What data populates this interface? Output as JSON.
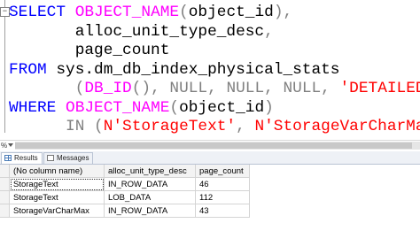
{
  "editor": {
    "lines": [
      [
        {
          "cls": "kw",
          "text": "SELECT "
        },
        {
          "cls": "fn",
          "text": "OBJECT_NAME"
        },
        {
          "cls": "gr",
          "text": "("
        },
        {
          "cls": "tx",
          "text": "object_id"
        },
        {
          "cls": "gr",
          "text": "),"
        }
      ],
      [
        {
          "cls": "tx",
          "text": "       alloc_unit_type_desc"
        },
        {
          "cls": "gr",
          "text": ","
        }
      ],
      [
        {
          "cls": "tx",
          "text": "       page_count"
        }
      ],
      [
        {
          "cls": "kw",
          "text": "FROM "
        },
        {
          "cls": "tx",
          "text": "sys.dm_db_index_physical_stats"
        }
      ],
      [
        {
          "cls": "gr",
          "text": "       ("
        },
        {
          "cls": "fn",
          "text": "DB_ID"
        },
        {
          "cls": "gr",
          "text": "(), "
        },
        {
          "cls": "gr",
          "text": "NULL"
        },
        {
          "cls": "gr",
          "text": ", "
        },
        {
          "cls": "gr",
          "text": "NULL"
        },
        {
          "cls": "gr",
          "text": ", "
        },
        {
          "cls": "gr",
          "text": "NULL"
        },
        {
          "cls": "gr",
          "text": ", "
        },
        {
          "cls": "str",
          "text": "'DETAILED'"
        },
        {
          "cls": "gr",
          "text": ")"
        }
      ],
      [
        {
          "cls": "kw",
          "text": "WHERE "
        },
        {
          "cls": "fn",
          "text": "OBJECT_NAME"
        },
        {
          "cls": "gr",
          "text": "("
        },
        {
          "cls": "tx",
          "text": "object_id"
        },
        {
          "cls": "gr",
          "text": ")"
        }
      ],
      [
        {
          "cls": "tx",
          "text": "      "
        },
        {
          "cls": "gr",
          "text": "IN ("
        },
        {
          "cls": "str",
          "text": "N'StorageText'"
        },
        {
          "cls": "gr",
          "text": ", "
        },
        {
          "cls": "str",
          "text": "N'StorageVarCharMax'"
        },
        {
          "cls": "gr",
          "text": ");"
        }
      ]
    ]
  },
  "zoom": {
    "label": "%"
  },
  "tabs": [
    {
      "label": "Results",
      "icon": "grid-icon"
    },
    {
      "label": "Messages",
      "icon": "message-icon"
    }
  ],
  "results": {
    "columns": [
      "(No column name)",
      "alloc_unit_type_desc",
      "page_count"
    ],
    "rows": [
      {
        "num": "",
        "cells": [
          "StorageText",
          "IN_ROW_DATA",
          "46"
        ]
      },
      {
        "num": "",
        "cells": [
          "StorageText",
          "LOB_DATA",
          "112"
        ]
      },
      {
        "num": "",
        "cells": [
          "StorageVarCharMax",
          "IN_ROW_DATA",
          "43"
        ]
      }
    ]
  }
}
